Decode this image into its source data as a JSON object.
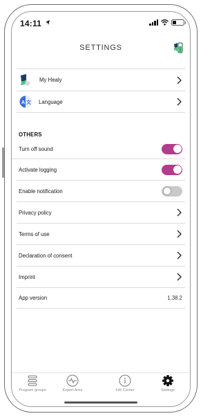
{
  "status": {
    "time": "14:11"
  },
  "header": {
    "title": "SETTINGS"
  },
  "top_items": [
    {
      "label": "My Healy",
      "icon": "healy-logo-icon"
    },
    {
      "label": "Language",
      "icon": "language-icon"
    }
  ],
  "others": {
    "title": "OTHERS",
    "toggles": [
      {
        "label": "Turn off sound",
        "on": true
      },
      {
        "label": "Activate logging",
        "on": true
      },
      {
        "label": "Enable notification",
        "on": false
      }
    ],
    "links": [
      {
        "label": "Privacy policy"
      },
      {
        "label": "Terms of use"
      },
      {
        "label": "Declaration of consent"
      },
      {
        "label": "Imprint"
      }
    ],
    "version": {
      "label": "App version",
      "value": "1.38.2"
    }
  },
  "tabs": [
    {
      "label": "Program groups",
      "icon": "program-groups-icon"
    },
    {
      "label": "Expert Area",
      "icon": "expert-area-icon"
    },
    {
      "label": "Info Center",
      "icon": "info-center-icon"
    },
    {
      "label": "Settings",
      "icon": "gear-icon"
    }
  ],
  "colors": {
    "accent": "#b53b8c",
    "toggle_off": "#c9c9c9",
    "divider": "#dcdcdc"
  }
}
